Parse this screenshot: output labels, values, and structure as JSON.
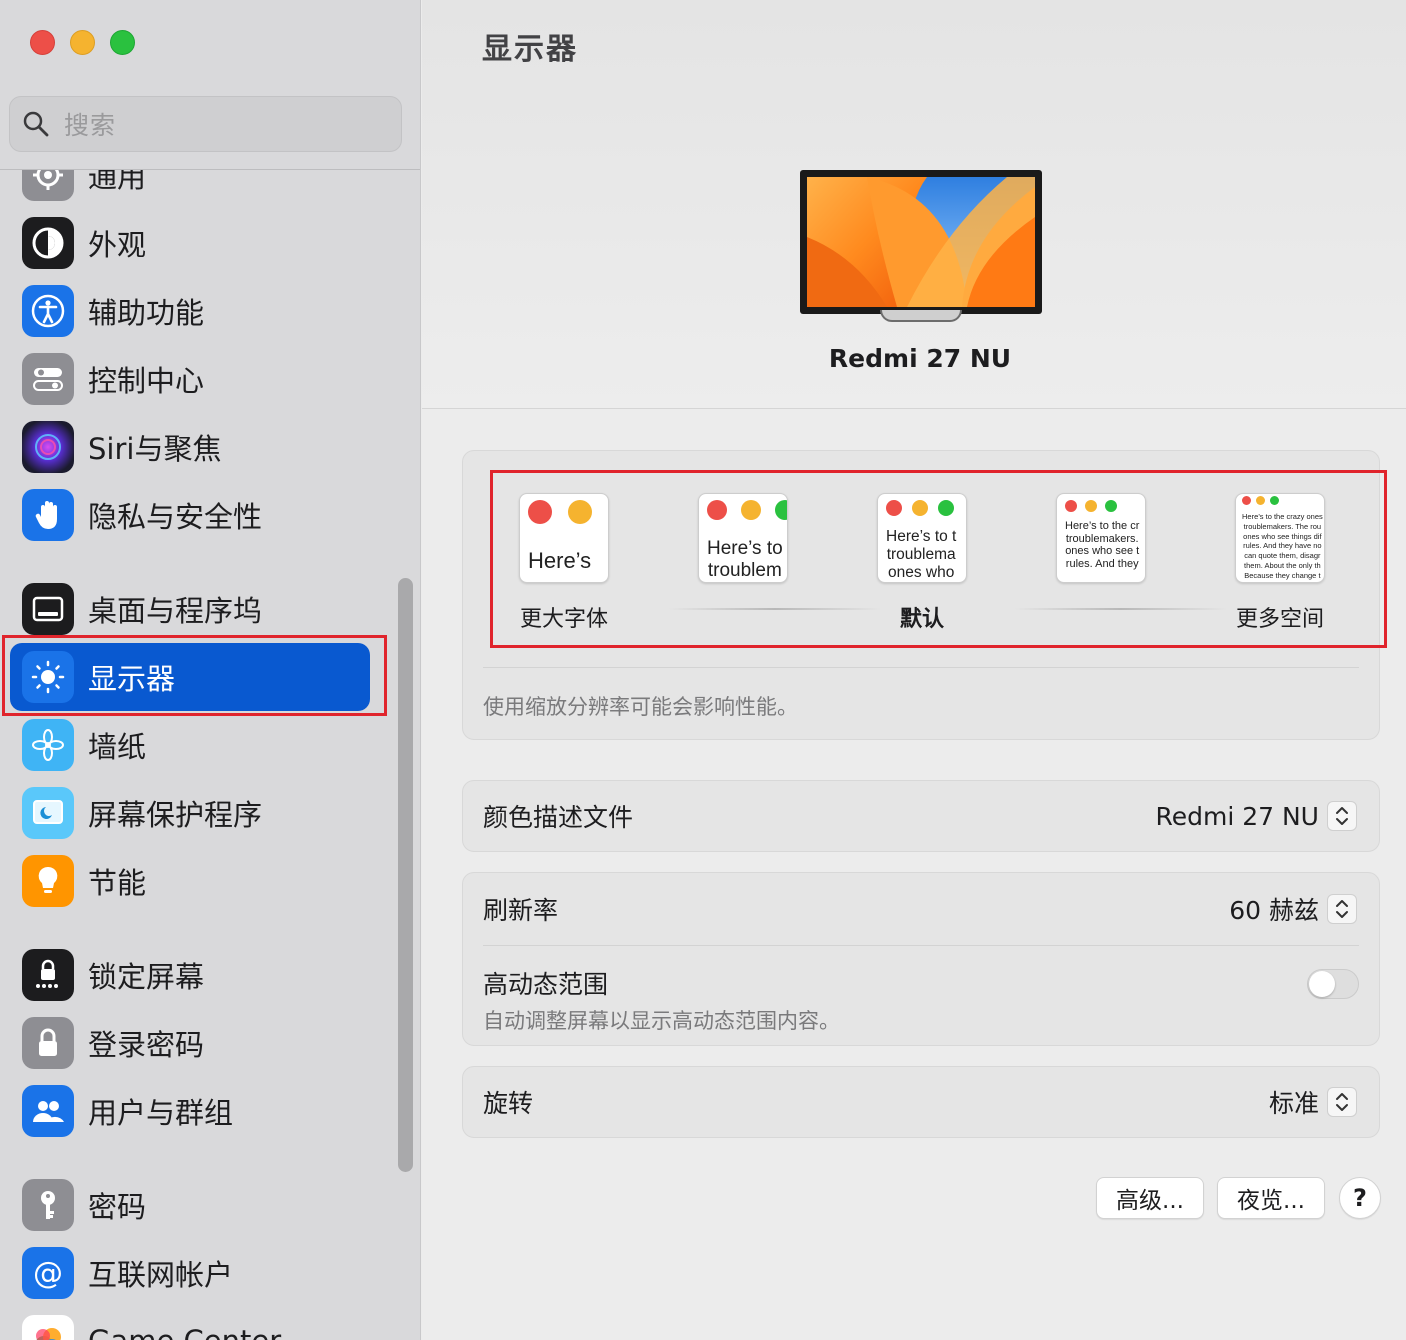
{
  "sidebar": {
    "search_placeholder": "搜索",
    "items": [
      {
        "label": "通用",
        "icon": "gear-icon"
      },
      {
        "label": "外观",
        "icon": "appearance-icon"
      },
      {
        "label": "辅助功能",
        "icon": "accessibility-icon"
      },
      {
        "label": "控制中心",
        "icon": "control-center-icon"
      },
      {
        "label": "Siri与聚焦",
        "icon": "siri-icon"
      },
      {
        "label": "隐私与安全性",
        "icon": "hand-icon"
      },
      {
        "label": "桌面与程序坞",
        "icon": "dock-icon"
      },
      {
        "label": "显示器",
        "icon": "display-icon"
      },
      {
        "label": "墙纸",
        "icon": "wallpaper-flower-icon"
      },
      {
        "label": "屏幕保护程序",
        "icon": "screensaver-icon"
      },
      {
        "label": "节能",
        "icon": "lightbulb-icon"
      },
      {
        "label": "锁定屏幕",
        "icon": "lock-screen-icon"
      },
      {
        "label": "登录密码",
        "icon": "padlock-icon"
      },
      {
        "label": "用户与群组",
        "icon": "users-icon"
      },
      {
        "label": "密码",
        "icon": "key-icon"
      },
      {
        "label": "互联网帐户",
        "icon": "at-icon"
      },
      {
        "label": "Game Center",
        "icon": "game-center-icon"
      }
    ],
    "selected": "显示器"
  },
  "main": {
    "title": "显示器",
    "monitor_name": "Redmi 27 NU",
    "resolution": {
      "options": [
        {
          "label": "更大字体",
          "preview": "Here’s"
        },
        {
          "label": "",
          "preview": "Here’s to\ntroublem"
        },
        {
          "label": "默认",
          "preview": "Here’s to t\ntroublema\nones who"
        },
        {
          "label": "",
          "preview": "Here’s to the cr\ntroublemakers.\nones who see t\nrules. And they"
        },
        {
          "label": "更多空间",
          "preview": "Here’s to the crazy ones\ntroublemakers. The rou\nones who see things dif\nrules. And they have no\ncan quote them, disagr\nthem. About the only th\nBecause they change t"
        }
      ],
      "selected_index": 2,
      "note": "使用缩放分辨率可能会影响性能。"
    },
    "color_profile": {
      "label": "颜色描述文件",
      "value": "Redmi 27 NU"
    },
    "refresh_rate": {
      "label": "刷新率",
      "value": "60 赫兹"
    },
    "hdr": {
      "label": "高动态范围",
      "description": "自动调整屏幕以显示高动态范围内容。",
      "enabled": false
    },
    "rotation": {
      "label": "旋转",
      "value": "标准"
    },
    "buttons": {
      "advanced": "高级...",
      "night_shift": "夜览...",
      "help": "?"
    }
  },
  "colors": {
    "accent": "#0959d0",
    "highlight_box": "#e0242c",
    "traffic_red": "#ed4f48",
    "traffic_yellow": "#f5b32f",
    "traffic_green": "#2ac13f"
  }
}
